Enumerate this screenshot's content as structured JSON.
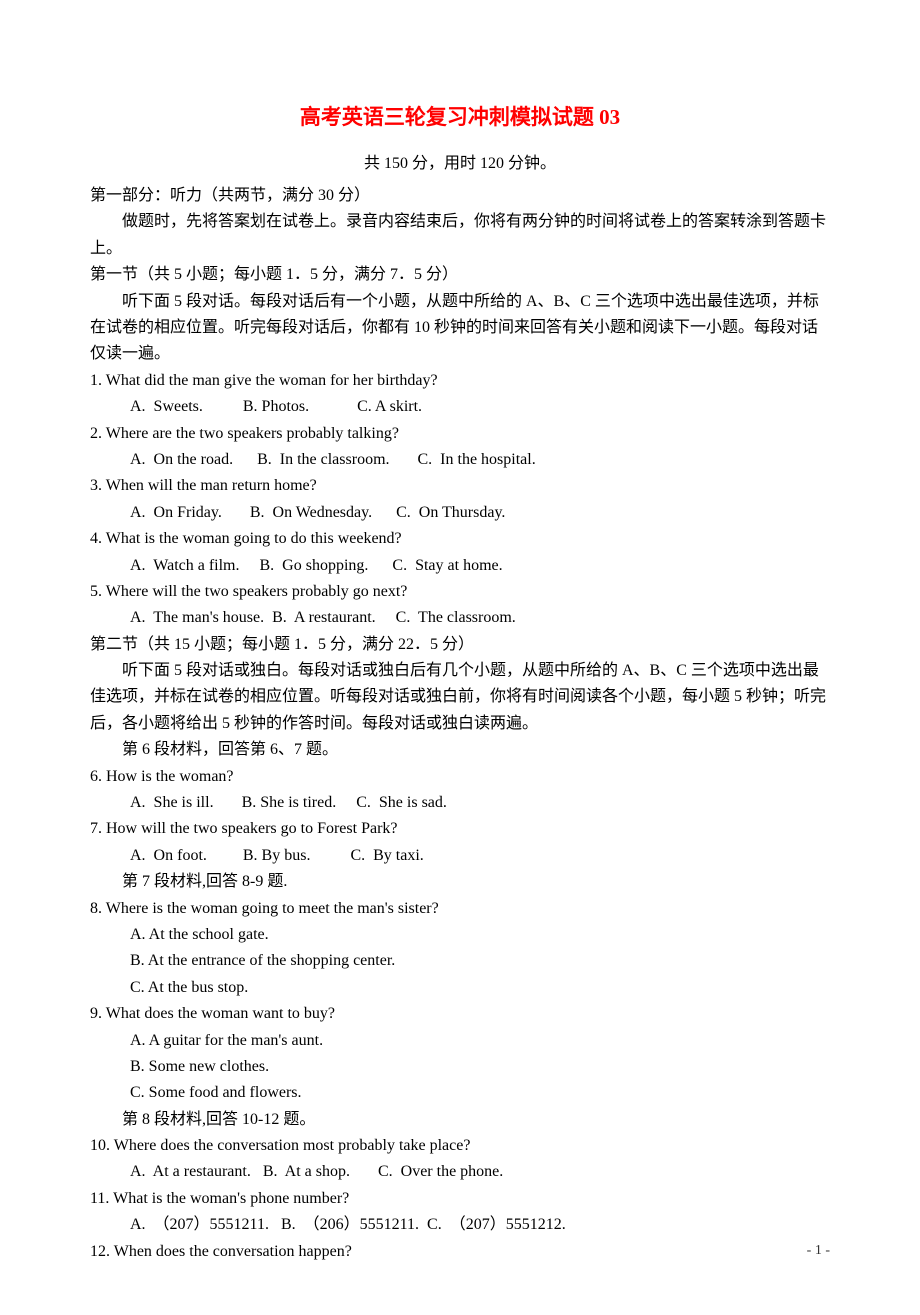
{
  "title": "高考英语三轮复习冲刺模拟试题 03",
  "subtitle": "共 150 分，用时 120 分钟。",
  "part1_heading": "第一部分：听力（共两节，满分 30 分）",
  "part1_instruction": "做题时，先将答案划在试卷上。录音内容结束后，你将有两分钟的时间将试卷上的答案转涂到答题卡上。",
  "section1_heading": "第一节（共 5 小题；每小题 1．5 分，满分 7．5 分）",
  "section1_instruction": "听下面 5 段对话。每段对话后有一个小题，从题中所给的    A、B、C 三个选项中选出最佳选项，并标在试卷的相应位置。听完每段对话后，你都有 10 秒钟的时间来回答有关小题和阅读下一小题。每段对话仅读一遍。",
  "q1": {
    "q": "1.  What did the man give the woman for her birthday?",
    "opts": "A.  Sweets.          B. Photos.            C. A skirt."
  },
  "q2": {
    "q": "2.  Where are the two speakers probably talking?",
    "opts": "A.  On the road.      B.  In the classroom.       C.  In the hospital."
  },
  "q3": {
    "q": "3.  When will the man return home?",
    "opts": "A.  On Friday.       B.  On Wednesday.      C.  On Thursday."
  },
  "q4": {
    "q": "4.  What is the woman going to do this weekend?",
    "opts": "A.  Watch a film.     B.  Go shopping.      C.  Stay at home."
  },
  "q5": {
    "q": "5.  Where will the two speakers probably go next?",
    "opts": "A.  The man's house.  B.  A restaurant.     C.  The classroom."
  },
  "section2_heading": "第二节（共 15 小题；每小题 1．5 分，满分 22．5 分）",
  "section2_instruction": "听下面 5 段对话或独白。每段对话或独白后有几个小题，从题中所给的 A、B、C 三个选项中选出最佳选项，并标在试卷的相应位置。听每段对话或独白前，你将有时间阅读各个小题，每小题 5 秒钟；听完后，各小题将给出 5 秒钟的作答时间。每段对话或独白读两遍。",
  "material6": "第 6 段材料，回答第 6、7 题。",
  "q6": {
    "q": "6. How is the woman?",
    "opts": "A.  She is ill.       B. She is tired.     C.  She is sad."
  },
  "q7": {
    "q": "7.  How will the two speakers go to Forest Park?",
    "opts": "A.  On foot.         B. By bus.          C.  By taxi."
  },
  "material7": "第 7 段材料,回答 8-9 题.",
  "q8": {
    "q": "8.  Where is the woman going to meet the man's sister?",
    "a": "A.  At the school gate.",
    "b": "B.  At the entrance of the shopping center.",
    "c": "C.  At the bus stop."
  },
  "q9": {
    "q": "9.  What does the woman want to buy?",
    "a": "A.  A guitar for the man's aunt.",
    "b": "B.  Some new clothes.",
    "c": "C.  Some food and flowers."
  },
  "material8": "第  8 段材料,回答 10-12 题。",
  "q10": {
    "q": "10.  Where does the conversation most probably take place?",
    "opts": "A.  At a restaurant.   B.  At a shop.       C.  Over the phone."
  },
  "q11": {
    "q": "11.  What is the woman's phone number?",
    "opts": "A.  （207）5551211.   B.  （206）5551211.  C.  （207）5551212."
  },
  "q12": {
    "q": "12.  When does the conversation happen?"
  },
  "pagenum": "- 1 -"
}
